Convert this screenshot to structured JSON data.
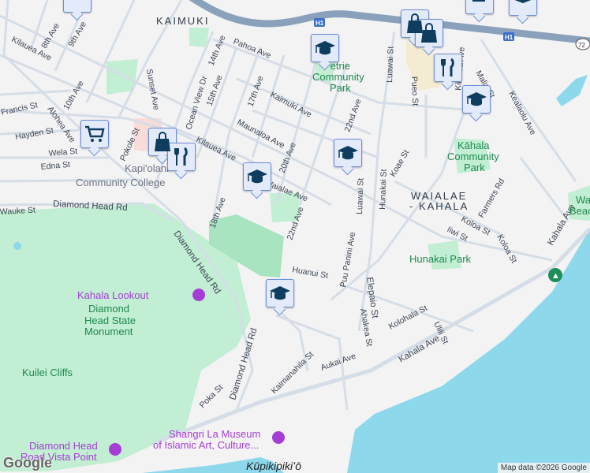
{
  "neighborhoods": [
    "KAIMUKI",
    "WAIALAE",
    "- KAHALA"
  ],
  "streets": [
    "Kilauea Ave",
    "8th Ave",
    "9th Ave",
    "Pahoa Ave",
    "14th Ave",
    "Sunset Ave",
    "Ocean View Dr",
    "15th Ave",
    "17th Ave",
    "Kaimuki Ave",
    "Maunaloa Ave",
    "20th Ave",
    "22nd Ave",
    "Luawai St",
    "Pueo St",
    "Kilauea Ave",
    "Malia St",
    "Kealaolu Ave",
    "Francis St",
    "Alohea Ave",
    "10th Ave",
    "Hayden St",
    "Wela St",
    "Edna St",
    "Pokole St",
    "Kilauea Ave",
    "Diamond Head Rd",
    "Wauke St",
    "18th Ave",
    "Koae St",
    "Hunakai St",
    "Luawai St",
    "Farmers Rd",
    "Koloa St",
    "Iiwi St",
    "Koloa St",
    "Kahala Ave",
    "Huanui St",
    "Puu Panini Ave",
    "Elepaio St",
    "Ahakea St",
    "Kolohala St",
    "Ulili St",
    "Diamond Head Rd",
    "Diamond Head Rd",
    "Kaimanahila St",
    "Aukai Ave",
    "Kahala Ave",
    "Poka St",
    "22nd Ave",
    "Waialae Ave"
  ],
  "parks": [
    "Petrie",
    "Community",
    "Park",
    "Kāhala",
    "Community",
    "Park",
    "Hunakai Park",
    "Diamond",
    "Head State",
    "Monument",
    "Kuilei Cliffs",
    "Wa",
    "Beac"
  ],
  "places": {
    "college": [
      "Kapi'olani",
      "Community College"
    ],
    "lookout": "Kahala Lookout",
    "vista": [
      "Diamond Head",
      "Road Vista Point"
    ],
    "museum": [
      "Shangri La Museum",
      "of Islamic Art, Culture..."
    ],
    "point": "Kūpikipikiʻō"
  },
  "highway": {
    "h1": "H1",
    "r72": "72"
  },
  "markers": [
    "shopping-cart",
    "shopping-bag",
    "restaurant",
    "school",
    "school",
    "school",
    "school",
    "school",
    "shopping-bag",
    "restaurant"
  ],
  "attribution": "Map data ©2026 Google",
  "logo": "Google",
  "colors": {
    "land": "#f4f3f4",
    "park": "#c2eed3",
    "water": "#8ed8ec",
    "highway": "#8aa1bb",
    "marker": "#e3ebfb",
    "poi": "#a53ed4"
  }
}
